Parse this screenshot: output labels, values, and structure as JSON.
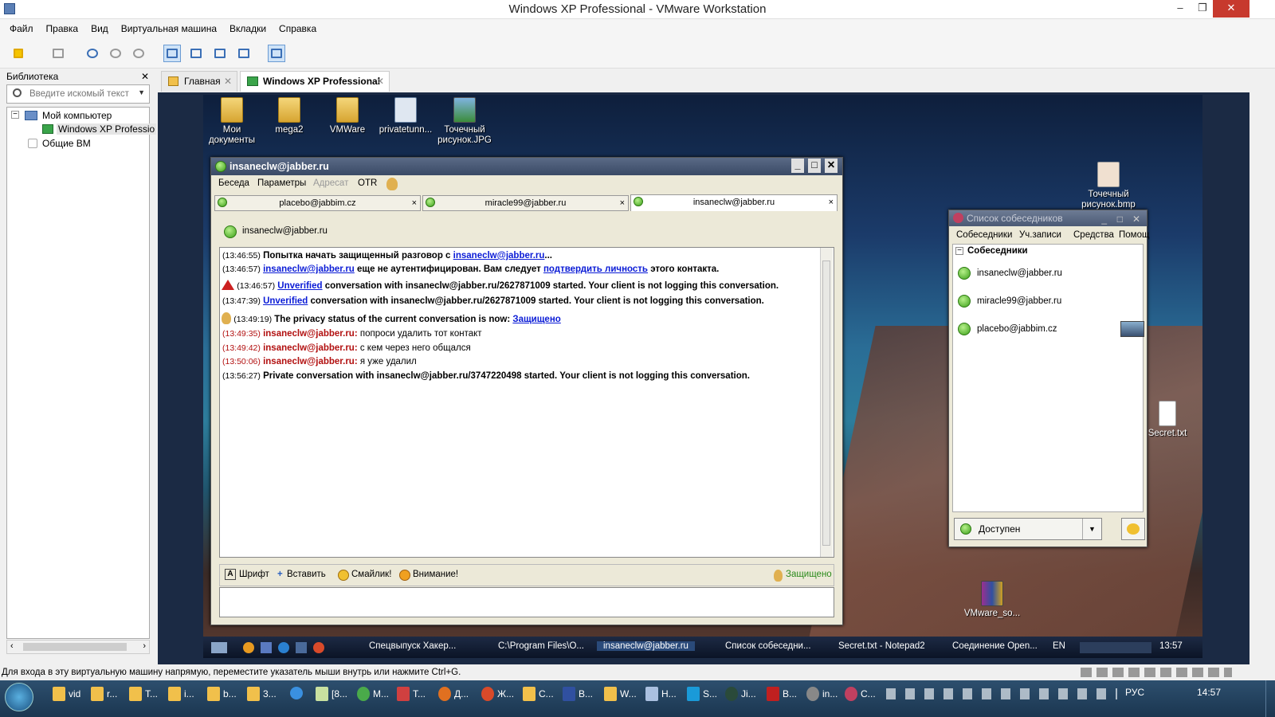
{
  "window": {
    "title": "Windows XP Professional - VMware Workstation",
    "minimize": "–",
    "restore": "❐",
    "close": "✕"
  },
  "menu": [
    "Файл",
    "Правка",
    "Вид",
    "Виртуальная машина",
    "Вкладки",
    "Справка"
  ],
  "library": {
    "title": "Библиотека",
    "close": "✕",
    "search_placeholder": "Введите искомый текст",
    "tree": [
      "Мой компьютер",
      "Windows XP Professio",
      "Общие ВМ"
    ]
  },
  "tabs": [
    {
      "label": "Главная",
      "close": "✕"
    },
    {
      "label": "Windows XP Professional",
      "close": "✕"
    }
  ],
  "desktop": {
    "icons": [
      "Мои документы",
      "mega2",
      "VMWare",
      "privatetunn...",
      "Точечный рисунок.JPG",
      "Точечный рисунок.bmp",
      "Secret.txt",
      "VMware_so..."
    ]
  },
  "chat": {
    "title": "insaneclw@jabber.ru",
    "menu": [
      "Беседа",
      "Параметры",
      "Адресат",
      "OTR"
    ],
    "tabs": [
      "placebo@jabbim.cz",
      "miracle99@jabber.ru",
      "insaneclw@jabber.ru"
    ],
    "tab_close": "×",
    "contact": "insaneclw@jabber.ru",
    "messages": {
      "m1": {
        "ts": "(13:46:55)",
        "pre": "Попытка начать защищенный разговор с ",
        "link": "insaneclw@jabber.ru",
        "post": "..."
      },
      "m2": {
        "ts": "(13:46:57)",
        "link1": "insaneclw@jabber.ru",
        "mid": " еще не аутентифицирован. Вам следует ",
        "link2": "подтвердить личность",
        "post": " этого контакта."
      },
      "m3": {
        "ts": "(13:46:57)",
        "link": "Unverified",
        "post": " conversation with insaneclw@jabber.ru/2627871009 started.  Your client is not logging this conversation."
      },
      "m4": {
        "ts": "(13:47:39)",
        "link": "Unverified",
        "post": " conversation with insaneclw@jabber.ru/2627871009 started.  Your client is not logging this conversation."
      },
      "m5": {
        "ts": "(13:49:19)",
        "pre": "The privacy status of the current conversation is now: ",
        "link": "Защищено"
      },
      "m6": {
        "ts": "(13:49:35)",
        "who": "insaneclw@jabber.ru:",
        "text": " попроси удалить тот контакт"
      },
      "m7": {
        "ts": "(13:49:42)",
        "who": "insaneclw@jabber.ru:",
        "text": " с кем через него общался"
      },
      "m8": {
        "ts": "(13:50:06)",
        "who": "insaneclw@jabber.ru:",
        "text": " я уже удалил"
      },
      "m9": {
        "ts": "(13:56:27)",
        "text": "Private conversation with insaneclw@jabber.ru/3747220498 started.  Your client is not logging this conversation."
      }
    },
    "toolbar": {
      "font": "Шрифт",
      "insert": "Вставить",
      "smiley": "Смайлик!",
      "attention": "Внимание!",
      "secure": "Защищено"
    }
  },
  "roster": {
    "title": "Список собеседников",
    "menu": [
      "Собеседники",
      "Уч.записи",
      "Средства",
      "Помощ"
    ],
    "group": "Собеседники",
    "contacts": [
      "insaneclw@jabber.ru",
      "miracle99@jabber.ru",
      "placebo@jabbim.cz"
    ],
    "status": "Доступен"
  },
  "guest_taskbar": {
    "items": [
      "Спецвыпуск Хакер...",
      "C:\\Program Files\\O...",
      "insaneclw@jabber.ru",
      "Список собеседни...",
      "Secret.txt - Notepad2",
      "Соединение Open..."
    ],
    "lang": "EN",
    "clock": "13:57"
  },
  "statusline": "Для входа в эту виртуальную машину напрямую, переместите указатель мыши внутрь или нажмите Ctrl+G.",
  "host_taskbar": {
    "items": [
      "vid",
      "r...",
      "T...",
      "i...",
      "b...",
      "3...",
      "[8...",
      "M...",
      "T...",
      "Д...",
      "Ж...",
      "C...",
      "B...",
      "W...",
      "H...",
      "S...",
      "Ji...",
      "B...",
      "in...",
      "C..."
    ],
    "lang": "РУС",
    "clock": "14:57"
  }
}
